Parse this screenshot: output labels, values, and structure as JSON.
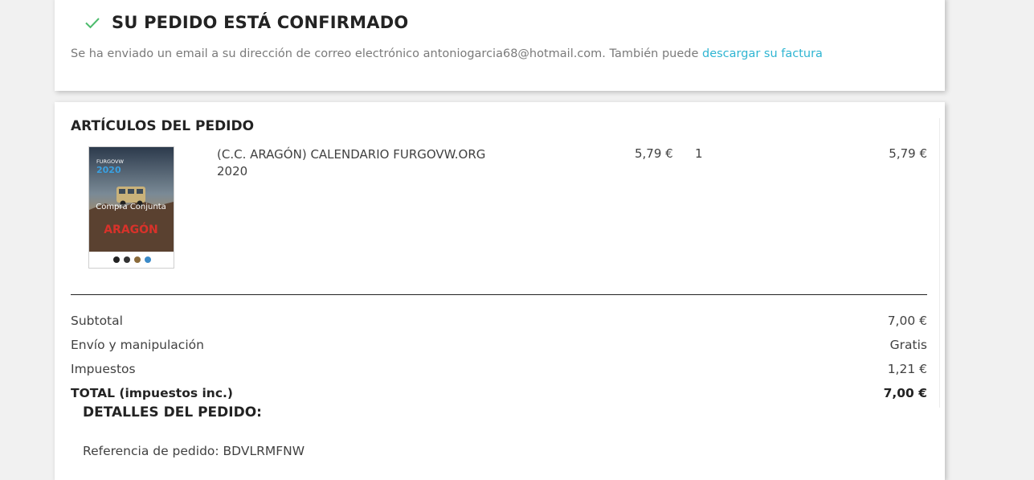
{
  "confirmation": {
    "title": "SU PEDIDO ESTÁ CONFIRMADO",
    "message": "Se ha enviado un email a su dirección de correo electrónico antoniogarcia68@hotmail.com. También puede ",
    "invoice_link": "descargar su factura",
    "accent_color": "#2fb5d2",
    "check_color": "#4cbb6c",
    "icon": "check-icon"
  },
  "order_items": {
    "title": "ARTÍCULOS DEL PEDIDO",
    "items": [
      {
        "name": "(C.C. ARAGÓN) CALENDARIO FURGOVW.ORG 2020",
        "unit_price": "5,79 €",
        "quantity": "1",
        "total": "5,79 €",
        "image": {
          "brand": "FURGOVW",
          "year": "2020",
          "caption": "Compra Conjunta",
          "region": "ARAGÓN"
        }
      }
    ]
  },
  "totals": [
    {
      "label": "Subtotal",
      "value": "7,00 €"
    },
    {
      "label": "Envío y manipulación",
      "value": "Gratis"
    },
    {
      "label": "Impuestos",
      "value": "1,21 €"
    },
    {
      "label": "TOTAL (impuestos inc.)",
      "value": "7,00 €"
    }
  ],
  "details": {
    "title": "DETALLES DEL PEDIDO:",
    "reference": "Referencia de pedido: BDVLRMFNW"
  }
}
